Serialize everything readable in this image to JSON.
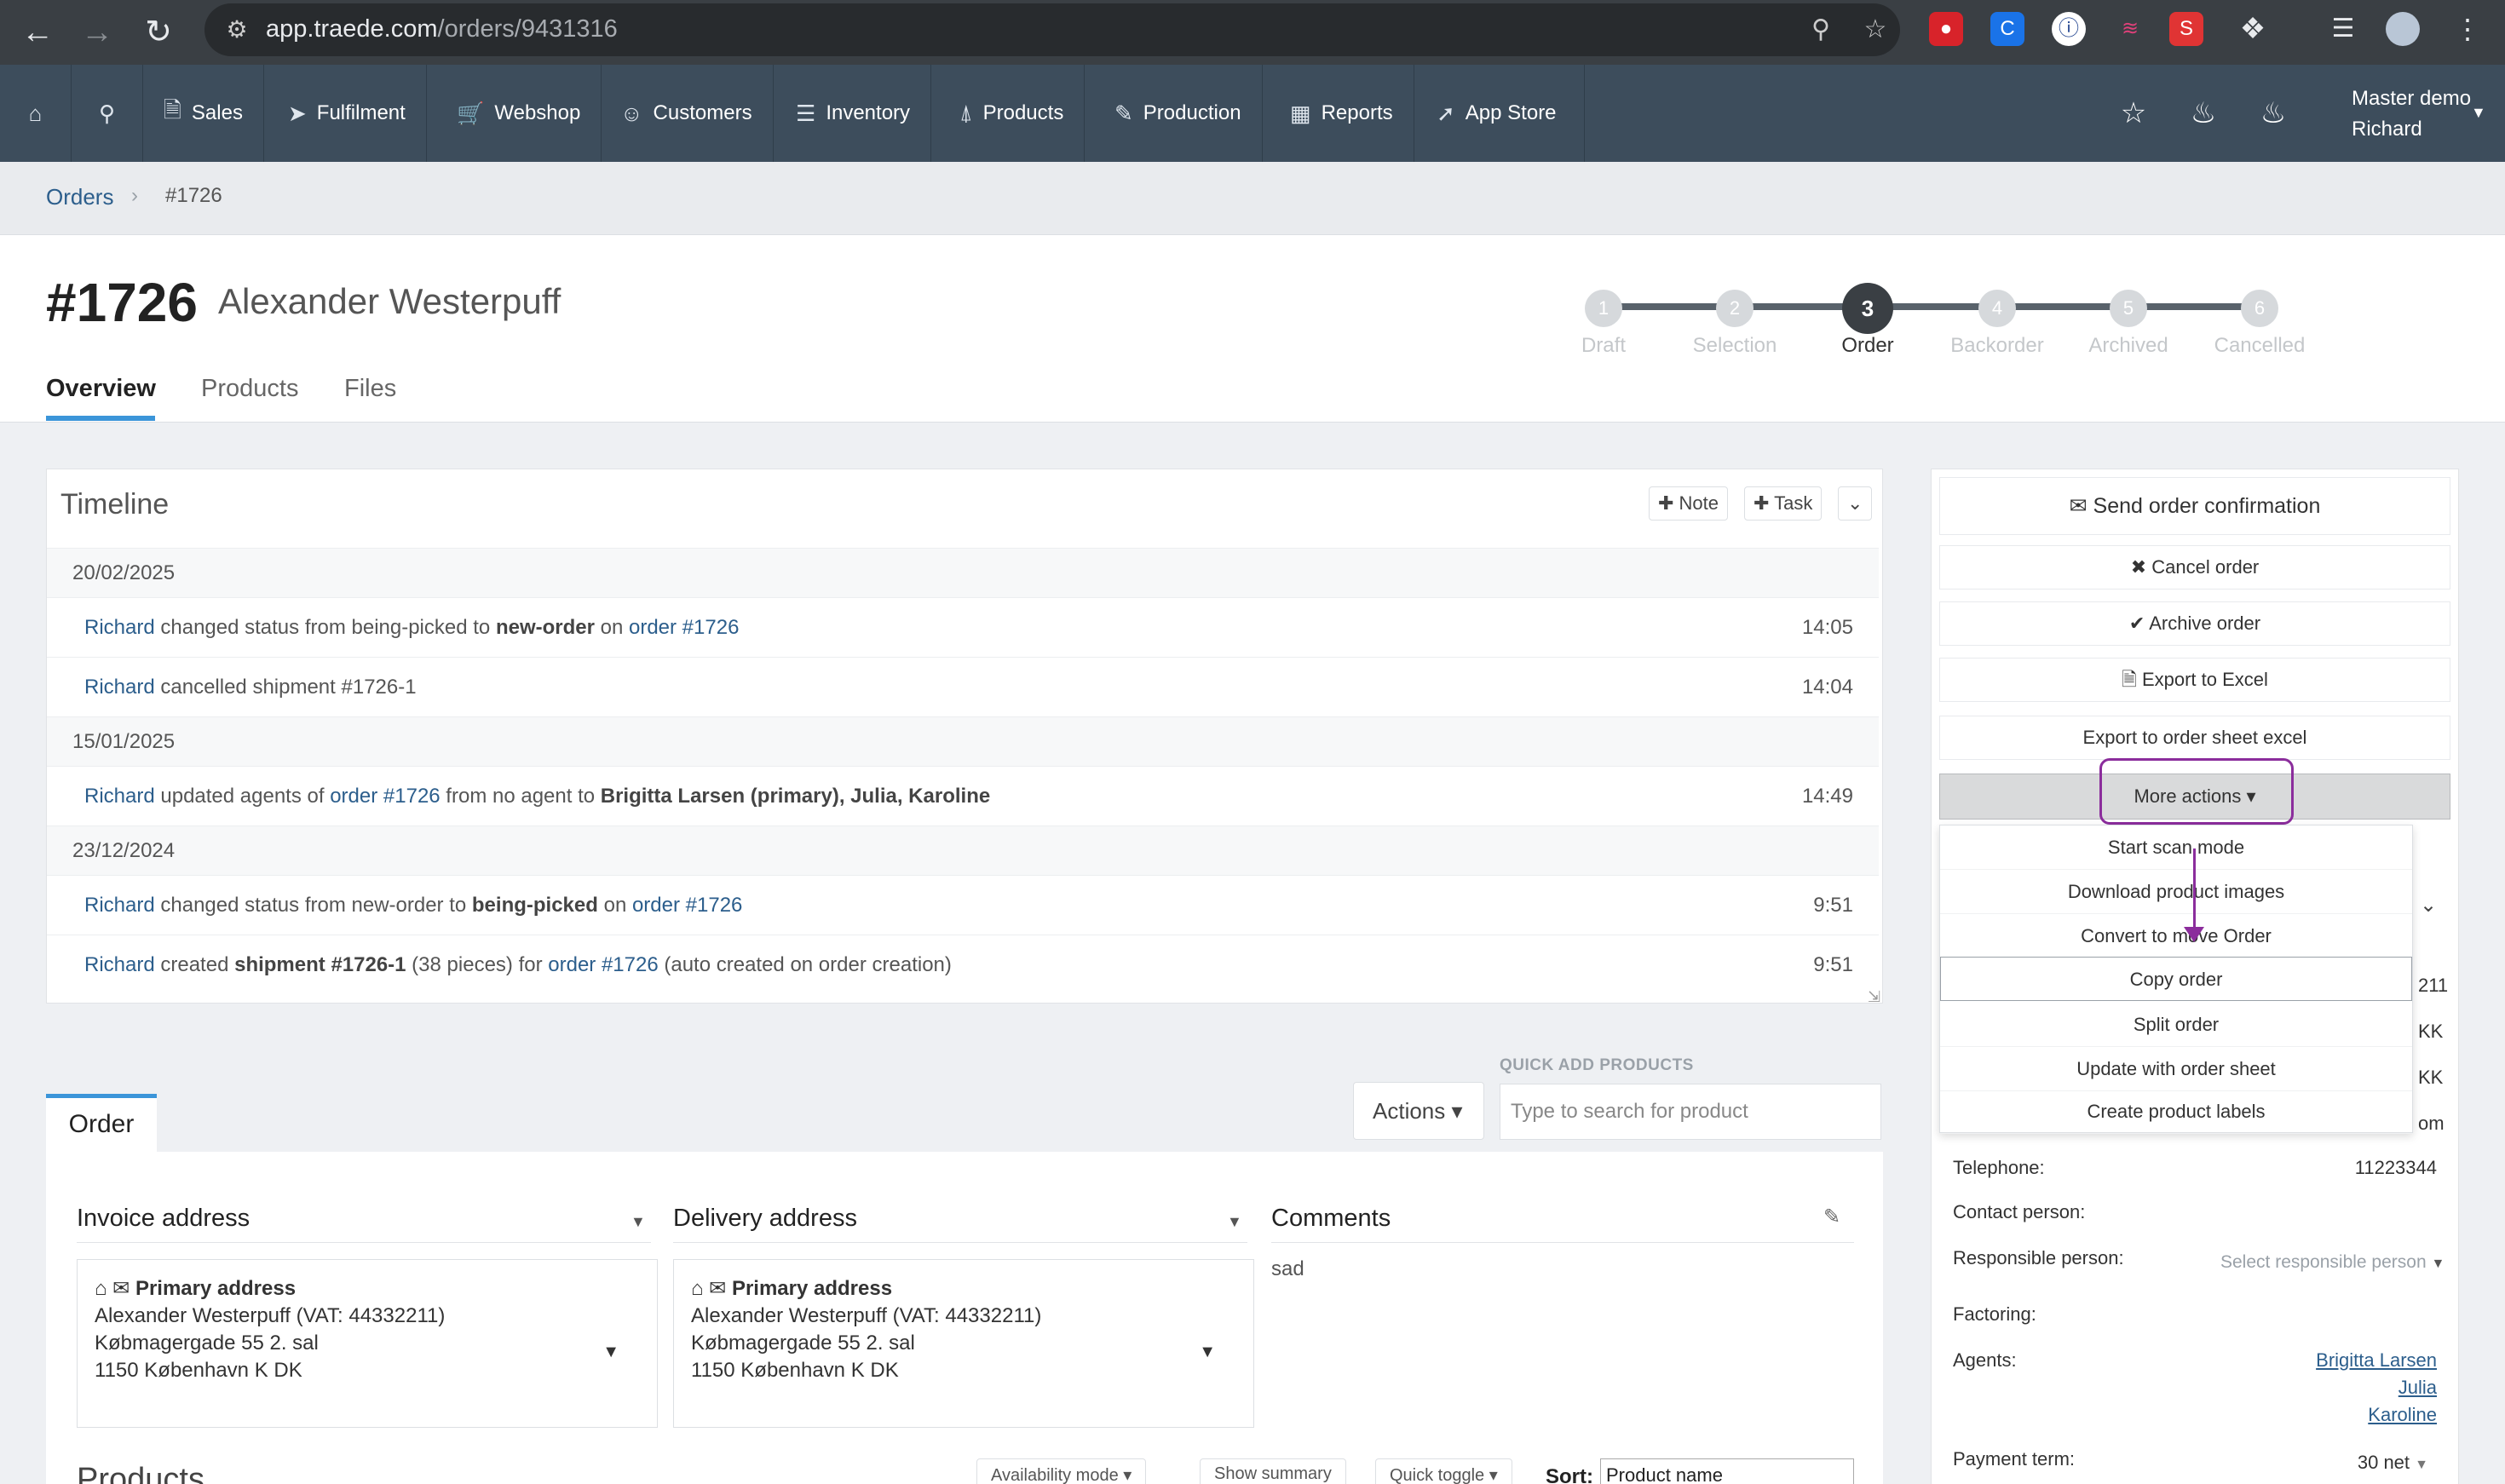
{
  "browser": {
    "url_host": "app.traede.com",
    "url_path": "/orders/9431316"
  },
  "nav": {
    "items": [
      {
        "label": "Sales",
        "icon": "file-icon"
      },
      {
        "label": "Fulfilment",
        "icon": "paper-plane-icon"
      },
      {
        "label": "Webshop",
        "icon": "cart-icon"
      },
      {
        "label": "Customers",
        "icon": "users-icon"
      },
      {
        "label": "Inventory",
        "icon": "layers-icon"
      },
      {
        "label": "Products",
        "icon": "shirt-icon"
      },
      {
        "label": "Production",
        "icon": "pencil-icon"
      },
      {
        "label": "Reports",
        "icon": "chart-icon"
      },
      {
        "label": "App Store",
        "icon": "rocket-icon"
      }
    ],
    "user_line1": "Master demo",
    "user_line2": "Richard"
  },
  "breadcrumb": {
    "parent": "Orders",
    "current": "#1726"
  },
  "header": {
    "order_number": "#1726",
    "customer_name": "Alexander Westerpuff",
    "tabs": [
      "Overview",
      "Products",
      "Files"
    ]
  },
  "steps": [
    {
      "num": "1",
      "label": "Draft"
    },
    {
      "num": "2",
      "label": "Selection"
    },
    {
      "num": "3",
      "label": "Order"
    },
    {
      "num": "4",
      "label": "Backorder"
    },
    {
      "num": "5",
      "label": "Archived"
    },
    {
      "num": "6",
      "label": "Cancelled"
    }
  ],
  "timeline": {
    "title": "Timeline",
    "note_label": "Note",
    "task_label": "Task",
    "dates": [
      "20/02/2025",
      "15/01/2025",
      "23/12/2024"
    ],
    "entries": [
      {
        "user": "Richard",
        "t1": " changed status from being-picked to ",
        "b1": "new-order",
        "t2": " on ",
        "l1": "order #1726",
        "time": "14:05"
      },
      {
        "user": "Richard",
        "t1": " cancelled shipment #1726-1",
        "time": "14:04"
      },
      {
        "user": "Richard",
        "t1": " updated agents of ",
        "l1": "order #1726",
        "t2": " from no agent to ",
        "b1": "Brigitta Larsen (primary), Julia, Karoline",
        "time": "14:49"
      },
      {
        "user": "Richard",
        "t1": " changed status from new-order to ",
        "b1": "being-picked",
        "t2": " on ",
        "l1": "order #1726",
        "time": "9:51"
      },
      {
        "user": "Richard",
        "t1": " created ",
        "b1": "shipment #1726-1",
        "t2": " (38 pieces) for ",
        "l1": "order #1726",
        "t3": " (auto created on order creation)",
        "time": "9:51"
      }
    ]
  },
  "order": {
    "tab_label": "Order",
    "actions_label": "Actions",
    "quick_add_label": "QUICK ADD PRODUCTS",
    "quick_add_placeholder": "Type to search for product",
    "invoice_title": "Invoice address",
    "delivery_title": "Delivery address",
    "comments_title": "Comments",
    "comment_text": "sad",
    "address": {
      "title": "Primary address",
      "line1": "Alexander Westerpuff (VAT: 44332211)",
      "line2": "Købmagergade 55 2. sal",
      "line3": "1150 København K DK"
    },
    "products_title": "Products",
    "availability_label": "Availability mode",
    "show_summary_label": "Show summary",
    "quick_toggle_label": "Quick toggle",
    "sort_label": "Sort:",
    "sort_value": "Product name"
  },
  "right": {
    "send_confirmation": "Send order confirmation",
    "cancel_order": "Cancel order",
    "archive_order": "Archive order",
    "export_excel": "Export to Excel",
    "export_sheet": "Export to order sheet excel",
    "more_actions": "More actions",
    "dropdown": [
      "Start scan mode",
      "Download product images",
      "Convert to move Order",
      "Copy order",
      "Split order",
      "Update with order sheet",
      "Create product labels"
    ],
    "peek": [
      "211",
      "KK",
      "KK",
      "om"
    ],
    "telephone_label": "Telephone:",
    "telephone_value": "11223344",
    "contact_label": "Contact person:",
    "responsible_label": "Responsible person:",
    "responsible_placeholder": "Select responsible person",
    "factoring_label": "Factoring:",
    "agents_label": "Agents:",
    "agents": [
      "Brigitta Larsen",
      "Julia",
      "Karoline"
    ],
    "payment_label": "Payment term:",
    "payment_value": "30 net"
  },
  "colors": {
    "nav_bg": "#3d4d5c",
    "accent": "#3b95d9",
    "link": "#2c5e8c",
    "highlight": "#8b2d9c"
  }
}
